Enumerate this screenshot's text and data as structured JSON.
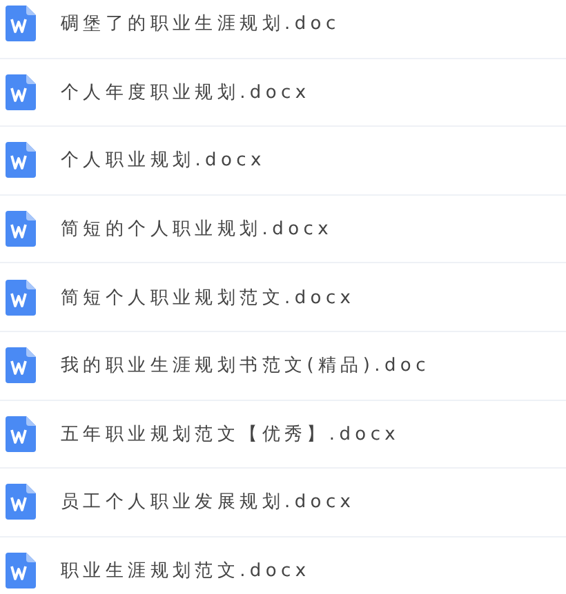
{
  "files": [
    {
      "name": "碉堡了的职业生涯规划.doc"
    },
    {
      "name": "个人年度职业规划.docx"
    },
    {
      "name": "个人职业规划.docx"
    },
    {
      "name": "简短的个人职业规划.docx"
    },
    {
      "name": "简短个人职业规划范文.docx"
    },
    {
      "name": "我的职业生涯规划书范文(精品).doc"
    },
    {
      "name": "五年职业规划范文【优秀】.docx"
    },
    {
      "name": "员工个人职业发展规划.docx"
    },
    {
      "name": "职业生涯规划范文.docx"
    }
  ]
}
